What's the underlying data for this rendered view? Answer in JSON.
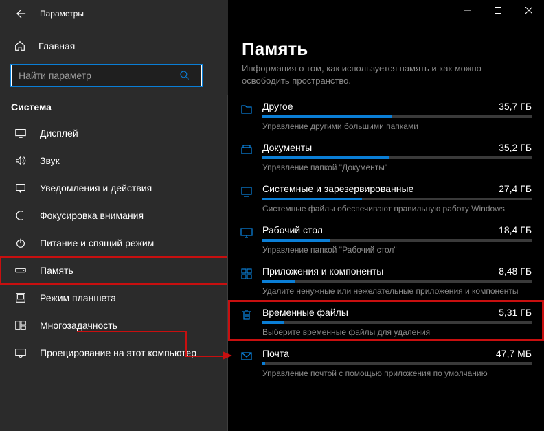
{
  "window": {
    "title": "Параметры"
  },
  "sidebar": {
    "home": "Главная",
    "search_placeholder": "Найти параметр",
    "section": "Система",
    "items": [
      {
        "label": "Дисплей"
      },
      {
        "label": "Звук"
      },
      {
        "label": "Уведомления и действия"
      },
      {
        "label": "Фокусировка внимания"
      },
      {
        "label": "Питание и спящий режим"
      },
      {
        "label": "Память"
      },
      {
        "label": "Режим планшета"
      },
      {
        "label": "Многозадачность"
      },
      {
        "label": "Проецирование на этот компьютер"
      }
    ]
  },
  "content": {
    "heading": "Память",
    "intro": "Информация о том, как используется память и как можно освободить пространство.",
    "categories": [
      {
        "name": "Другое",
        "size": "35,7 ГБ",
        "pct": 48,
        "desc": "Управление другими большими папками"
      },
      {
        "name": "Документы",
        "size": "35,2 ГБ",
        "pct": 47,
        "desc": "Управление папкой \"Документы\""
      },
      {
        "name": "Системные и зарезервированные",
        "size": "27,4 ГБ",
        "pct": 37,
        "desc": "Системные файлы обеспечивают правильную работу Windows"
      },
      {
        "name": "Рабочий стол",
        "size": "18,4 ГБ",
        "pct": 25,
        "desc": "Управление папкой \"Рабочий стол\""
      },
      {
        "name": "Приложения и компоненты",
        "size": "8,48 ГБ",
        "pct": 12,
        "desc": "Удалите ненужные или нежелательные приложения и компоненты"
      },
      {
        "name": "Временные файлы",
        "size": "5,31 ГБ",
        "pct": 8,
        "desc": "Выберите временные файлы для удаления"
      },
      {
        "name": "Почта",
        "size": "47,7 МБ",
        "pct": 1,
        "desc": "Управление почтой с помощью приложения по умолчанию"
      }
    ]
  }
}
